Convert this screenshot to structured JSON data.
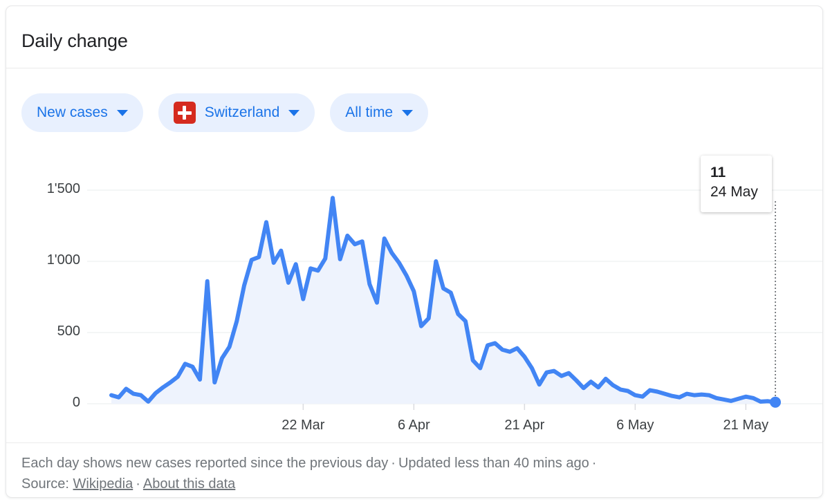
{
  "header": {
    "title": "Daily change"
  },
  "filters": [
    {
      "name": "metric",
      "label": "New cases",
      "icon": "chevron-down-icon",
      "flag": null
    },
    {
      "name": "country",
      "label": "Switzerland",
      "icon": "chevron-down-icon",
      "flag": "switzerland-flag-icon"
    },
    {
      "name": "timerange",
      "label": "All time",
      "icon": "chevron-down-icon",
      "flag": null
    }
  ],
  "tooltip": {
    "value": "11",
    "date": "24 May"
  },
  "footer": {
    "line1_text": "Each day shows new cases reported since the previous day",
    "line1_sep": "·",
    "line1_updated": "Updated less than 40 mins ago",
    "line1_end_sep": "·",
    "source_label": "Source:",
    "source_link": "Wikipedia",
    "source_sep": "·",
    "about_link": "About this data"
  },
  "colors": {
    "accent": "#1a73e8",
    "line": "#4285f4",
    "area": "#eef3fd",
    "chip_bg": "#e8f0fe",
    "flag_red": "#d52b1e",
    "grid": "#f1f3f4",
    "text": "#202124",
    "muted": "#70757a"
  },
  "chart_data": {
    "type": "line",
    "title": "Daily change",
    "xlabel": "",
    "ylabel": "",
    "ylim": [
      0,
      1600
    ],
    "yticks": [
      0,
      500,
      1000,
      1500
    ],
    "ytick_labels": [
      "0",
      "500",
      "1'000",
      "1'500"
    ],
    "grid": true,
    "legend": null,
    "xtick_labels": [
      "22 Mar",
      "6 Apr",
      "21 Apr",
      "6 May",
      "21 May"
    ],
    "xtick_indices": [
      26,
      41,
      56,
      71,
      86
    ],
    "x": [
      "24 Feb",
      "25 Feb",
      "26 Feb",
      "27 Feb",
      "28 Feb",
      "29 Feb",
      "1 Mar",
      "2 Mar",
      "3 Mar",
      "4 Mar",
      "5 Mar",
      "6 Mar",
      "7 Mar",
      "8 Mar",
      "9 Mar",
      "10 Mar",
      "11 Mar",
      "12 Mar",
      "13 Mar",
      "14 Mar",
      "15 Mar",
      "16 Mar",
      "17 Mar",
      "18 Mar",
      "19 Mar",
      "20 Mar",
      "21 Mar",
      "22 Mar",
      "23 Mar",
      "24 Mar",
      "25 Mar",
      "26 Mar",
      "27 Mar",
      "28 Mar",
      "29 Mar",
      "30 Mar",
      "31 Mar",
      "1 Apr",
      "2 Apr",
      "3 Apr",
      "4 Apr",
      "5 Apr",
      "6 Apr",
      "7 Apr",
      "8 Apr",
      "9 Apr",
      "10 Apr",
      "11 Apr",
      "12 Apr",
      "13 Apr",
      "14 Apr",
      "15 Apr",
      "16 Apr",
      "17 Apr",
      "18 Apr",
      "19 Apr",
      "20 Apr",
      "21 Apr",
      "22 Apr",
      "23 Apr",
      "24 Apr",
      "25 Apr",
      "26 Apr",
      "27 Apr",
      "28 Apr",
      "29 Apr",
      "30 Apr",
      "1 May",
      "2 May",
      "3 May",
      "4 May",
      "5 May",
      "6 May",
      "7 May",
      "8 May",
      "9 May",
      "10 May",
      "11 May",
      "12 May",
      "13 May",
      "14 May",
      "15 May",
      "16 May",
      "17 May",
      "18 May",
      "19 May",
      "20 May",
      "21 May",
      "22 May",
      "23 May",
      "24 May"
    ],
    "values": [
      60,
      45,
      105,
      70,
      60,
      15,
      75,
      115,
      150,
      190,
      280,
      260,
      170,
      860,
      150,
      320,
      400,
      580,
      830,
      1010,
      1030,
      1275,
      990,
      1075,
      850,
      980,
      735,
      950,
      935,
      1020,
      1445,
      1015,
      1180,
      1120,
      1140,
      840,
      710,
      1160,
      1060,
      990,
      900,
      790,
      545,
      600,
      1000,
      810,
      780,
      630,
      580,
      305,
      250,
      410,
      425,
      380,
      365,
      390,
      330,
      250,
      135,
      220,
      230,
      195,
      215,
      165,
      110,
      155,
      115,
      175,
      130,
      100,
      90,
      60,
      50,
      95,
      85,
      70,
      55,
      45,
      70,
      60,
      65,
      60,
      40,
      30,
      20,
      35,
      50,
      40,
      15,
      18,
      11
    ],
    "highlight": {
      "index": 90,
      "label": "24 May",
      "value": 11
    }
  }
}
